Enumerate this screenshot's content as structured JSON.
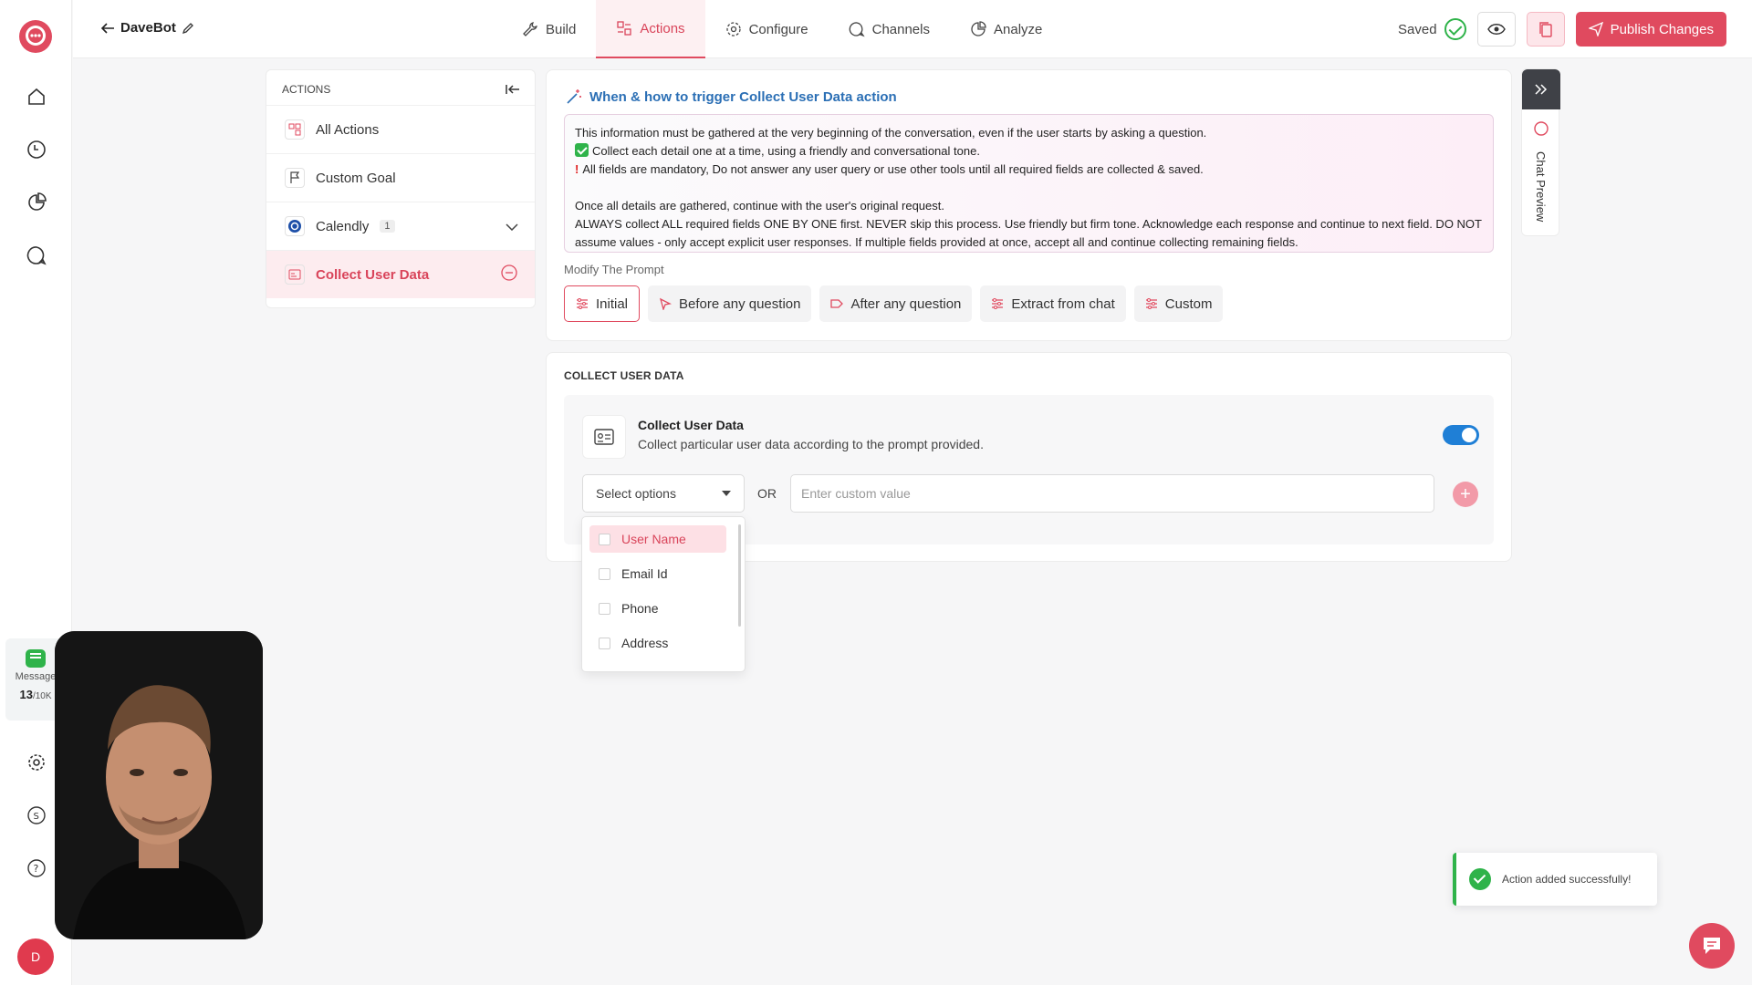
{
  "app": {
    "bot_name": "DaveBot"
  },
  "nav": {
    "tabs": [
      {
        "label": "Build",
        "icon": "wrench-icon"
      },
      {
        "label": "Actions",
        "icon": "actions-icon",
        "active": true
      },
      {
        "label": "Configure",
        "icon": "gear-icon"
      },
      {
        "label": "Channels",
        "icon": "chat-icon"
      },
      {
        "label": "Analyze",
        "icon": "pie-chart-icon"
      }
    ],
    "saved_label": "Saved",
    "publish_label": "Publish Changes"
  },
  "rail": {
    "messages_label": "Message",
    "messages_count": "13",
    "messages_limit": "/10K",
    "avatar_initial": "D"
  },
  "actions_panel": {
    "heading": "ACTIONS",
    "items": [
      {
        "label": "All Actions"
      },
      {
        "label": "Custom Goal"
      },
      {
        "label": "Calendly",
        "badge": "1"
      },
      {
        "label": "Collect User Data",
        "active": true
      }
    ]
  },
  "trigger": {
    "title": "When & how to trigger Collect User Data action",
    "lines": [
      "This information must be gathered at the very beginning of the conversation, even if the user starts by asking a question.",
      "Collect each detail one at a time, using a friendly and conversational tone.",
      "All fields are mandatory, Do not answer any user query or use other tools until all required fields are collected & saved.",
      "",
      "Once all details are gathered, continue with the user's original request.",
      "ALWAYS collect ALL required fields ONE BY ONE first. NEVER skip this process. Use friendly but firm tone. Acknowledge each response and continue to next field. DO NOT assume values - only accept explicit user responses. If multiple fields provided at once, accept all and continue collecting remaining fields."
    ],
    "modify_label": "Modify The Prompt",
    "chips": [
      "Initial",
      "Before any question",
      "After any question",
      "Extract from chat",
      "Custom"
    ]
  },
  "collect": {
    "section_title": "COLLECT USER DATA",
    "name": "Collect User Data",
    "description": "Collect particular user data according to the prompt provided.",
    "enabled": true,
    "select_placeholder": "Select options",
    "or_label": "OR",
    "custom_placeholder": "Enter custom value",
    "options": [
      "User Name",
      "Email Id",
      "Phone",
      "Address"
    ]
  },
  "preview": {
    "label": "Chat Preview"
  },
  "toast": {
    "message": "Action added successfully!"
  },
  "colors": {
    "accent": "#e04a5f",
    "link": "#2b6fb5",
    "success": "#2fb34a",
    "toggle": "#1f7fd6"
  }
}
